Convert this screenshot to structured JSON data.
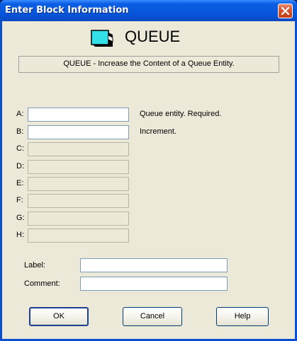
{
  "window": {
    "title": "Enter Block Information",
    "close_glyph": "x-icon"
  },
  "block": {
    "name": "QUEUE",
    "icon": "queue-block-icon",
    "description": "QUEUE - Increase the Content of a Queue Entity."
  },
  "operands": [
    {
      "label": "A:",
      "value": "",
      "hint": "Queue entity. Required.",
      "enabled": true
    },
    {
      "label": "B:",
      "value": "",
      "hint": "Increment.",
      "enabled": true
    },
    {
      "label": "C:",
      "value": "",
      "hint": "",
      "enabled": false
    },
    {
      "label": "D:",
      "value": "",
      "hint": "",
      "enabled": false
    },
    {
      "label": "E:",
      "value": "",
      "hint": "",
      "enabled": false
    },
    {
      "label": "F:",
      "value": "",
      "hint": "",
      "enabled": false
    },
    {
      "label": "G:",
      "value": "",
      "hint": "",
      "enabled": false
    },
    {
      "label": "H:",
      "value": "",
      "hint": "",
      "enabled": false
    }
  ],
  "fields": {
    "label_caption": "Label:",
    "label_value": "",
    "comment_caption": "Comment:",
    "comment_value": ""
  },
  "buttons": {
    "ok": "OK",
    "cancel": "Cancel",
    "help": "Help"
  },
  "colors": {
    "titlebar": "#0754d8",
    "dialog_bg": "#ece9d8",
    "icon_fill": "#33e0e8"
  }
}
